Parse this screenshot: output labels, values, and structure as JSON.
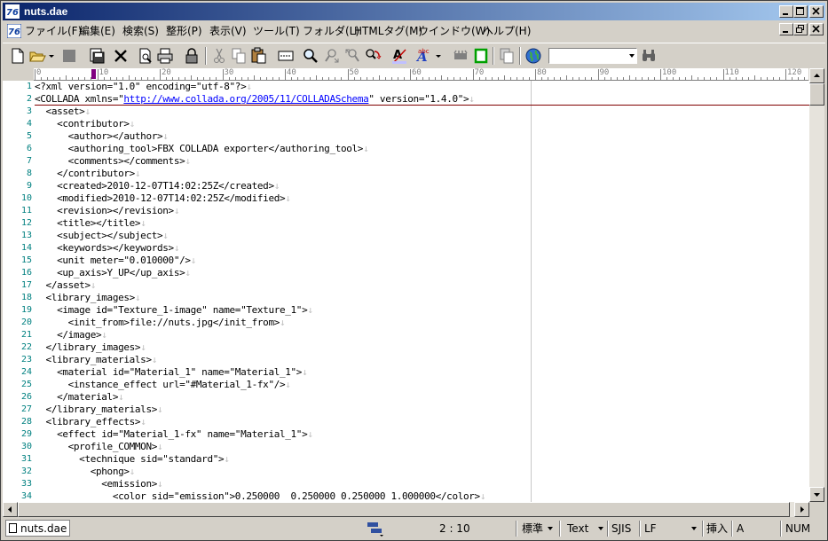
{
  "window": {
    "title": "nuts.dae"
  },
  "menu": {
    "items": [
      "ファイル(F)",
      "編集(E)",
      "検索(S)",
      "整形(P)",
      "表示(V)",
      "ツール(T)",
      "フォルダ(L)",
      "HTMLタグ(M)",
      "ウインドウ(W)",
      "ヘルプ(H)"
    ]
  },
  "ruler": {
    "labels": [
      "0",
      "10",
      "20",
      "30",
      "40",
      "50",
      "60",
      "70",
      "80",
      "90",
      "100",
      "110",
      "120"
    ]
  },
  "editor": {
    "lines": [
      {
        "n": "1",
        "t": "<?xml version=\"1.0\" encoding=\"utf-8\"?>"
      },
      {
        "n": "2",
        "t": "<COLLADA xmlns=\"",
        "link": "http://www.collada.org/2005/11/COLLADASchema",
        "t2": "\" version=\"1.4.0\">"
      },
      {
        "n": "3",
        "t": "  <asset>"
      },
      {
        "n": "4",
        "t": "    <contributor>"
      },
      {
        "n": "5",
        "t": "      <author></author>"
      },
      {
        "n": "6",
        "t": "      <authoring_tool>FBX COLLADA exporter</authoring_tool>"
      },
      {
        "n": "7",
        "t": "      <comments></comments>"
      },
      {
        "n": "8",
        "t": "    </contributor>"
      },
      {
        "n": "9",
        "t": "    <created>2010-12-07T14:02:25Z</created>"
      },
      {
        "n": "10",
        "t": "    <modified>2010-12-07T14:02:25Z</modified>"
      },
      {
        "n": "11",
        "t": "    <revision></revision>"
      },
      {
        "n": "12",
        "t": "    <title></title>"
      },
      {
        "n": "13",
        "t": "    <subject></subject>"
      },
      {
        "n": "14",
        "t": "    <keywords></keywords>"
      },
      {
        "n": "15",
        "t": "    <unit meter=\"0.010000\"/>"
      },
      {
        "n": "16",
        "t": "    <up_axis>Y_UP</up_axis>"
      },
      {
        "n": "17",
        "t": "  </asset>"
      },
      {
        "n": "18",
        "t": "  <library_images>"
      },
      {
        "n": "19",
        "t": "    <image id=\"Texture_1-image\" name=\"Texture_1\">"
      },
      {
        "n": "20",
        "t": "      <init_from>file://nuts.jpg</init_from>"
      },
      {
        "n": "21",
        "t": "    </image>"
      },
      {
        "n": "22",
        "t": "  </library_images>"
      },
      {
        "n": "23",
        "t": "  <library_materials>"
      },
      {
        "n": "24",
        "t": "    <material id=\"Material_1\" name=\"Material_1\">"
      },
      {
        "n": "25",
        "t": "      <instance_effect url=\"#Material_1-fx\"/>"
      },
      {
        "n": "26",
        "t": "    </material>"
      },
      {
        "n": "27",
        "t": "  </library_materials>"
      },
      {
        "n": "28",
        "t": "  <library_effects>"
      },
      {
        "n": "29",
        "t": "    <effect id=\"Material_1-fx\" name=\"Material_1\">"
      },
      {
        "n": "30",
        "t": "      <profile_COMMON>"
      },
      {
        "n": "31",
        "t": "        <technique sid=\"standard\">"
      },
      {
        "n": "32",
        "t": "          <phong>"
      },
      {
        "n": "33",
        "t": "            <emission>"
      },
      {
        "n": "34",
        "t": "              <color sid=\"emission\">0.250000  0.250000 0.250000 1.000000</color>"
      }
    ]
  },
  "status": {
    "tab_label": "nuts.dae",
    "position": "2 : 10",
    "mode": "標準",
    "type": "Text",
    "encoding": "SJIS",
    "line_end": "LF",
    "insert": "挿入",
    "ime": "A",
    "num": "NUM"
  },
  "colors": {
    "title_start": "#0a246a",
    "title_end": "#a6caf0",
    "line_numbers": "#008080",
    "link": "#0000ff",
    "current_line": "#800000"
  }
}
